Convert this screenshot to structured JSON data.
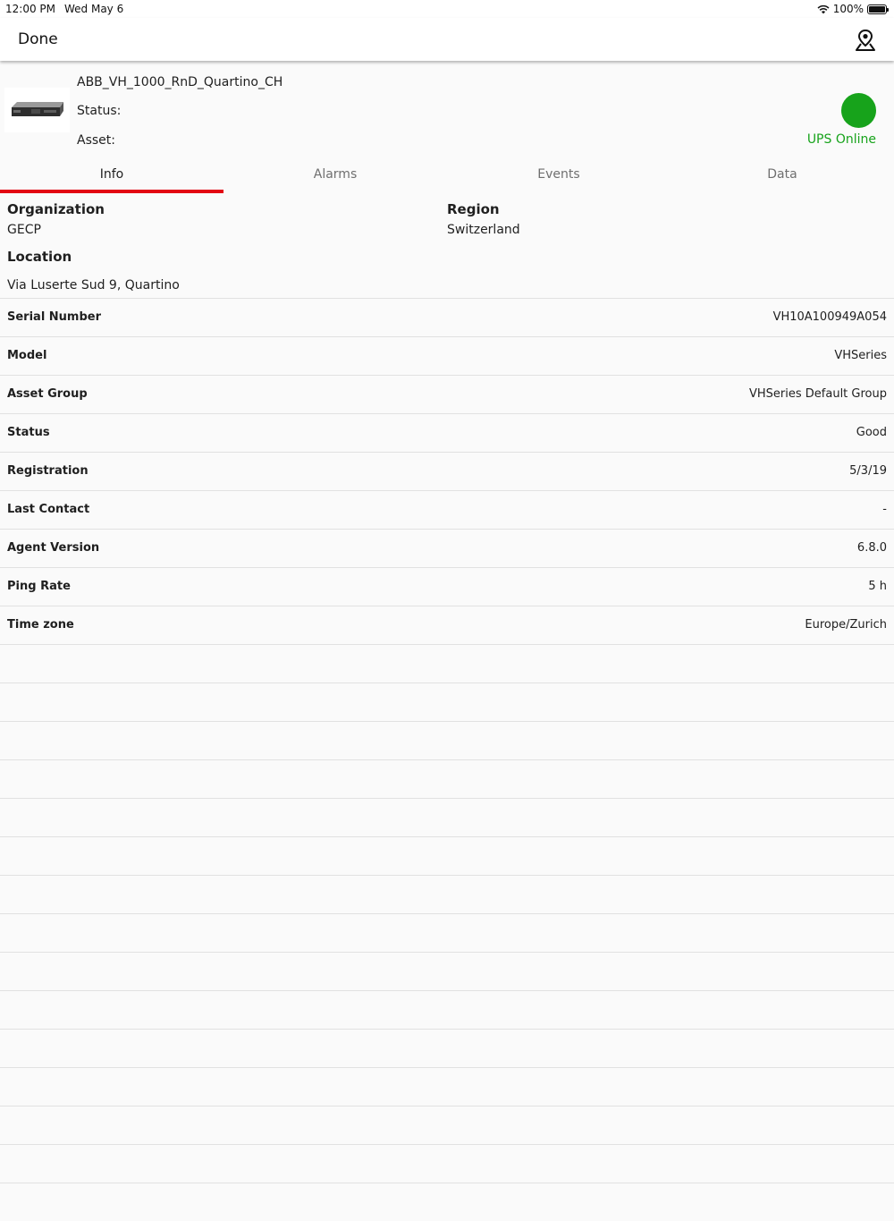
{
  "status_bar": {
    "time": "12:00 PM",
    "date": "Wed May 6",
    "battery": "100%"
  },
  "nav": {
    "done_label": "Done",
    "map_icon": "map-pin-icon"
  },
  "device": {
    "name": "ABB_VH_1000_RnD_Quartino_CH",
    "status_label": "Status:",
    "asset_label": "Asset:",
    "state_text": "UPS Online",
    "state_color": "#17a31b"
  },
  "tabs": [
    {
      "label": "Info",
      "active": true
    },
    {
      "label": "Alarms",
      "active": false
    },
    {
      "label": "Events",
      "active": false
    },
    {
      "label": "Data",
      "active": false
    }
  ],
  "info": {
    "organization": {
      "label": "Organization",
      "value": "GECP"
    },
    "region": {
      "label": "Region",
      "value": "Switzerland"
    },
    "location": {
      "label": "Location",
      "value": "Via Luserte Sud 9, Quartino"
    }
  },
  "details": [
    {
      "label": "Serial Number",
      "value": "VH10A100949A054"
    },
    {
      "label": "Model",
      "value": "VHSeries"
    },
    {
      "label": "Asset Group",
      "value": "VHSeries Default Group"
    },
    {
      "label": "Status",
      "value": "Good"
    },
    {
      "label": "Registration",
      "value": "5/3/19"
    },
    {
      "label": "Last Contact",
      "value": "-"
    },
    {
      "label": "Agent Version",
      "value": "6.8.0"
    },
    {
      "label": "Ping Rate",
      "value": "5 h"
    },
    {
      "label": "Time zone",
      "value": "Europe/Zurich"
    }
  ],
  "accent_color": "#e30613"
}
